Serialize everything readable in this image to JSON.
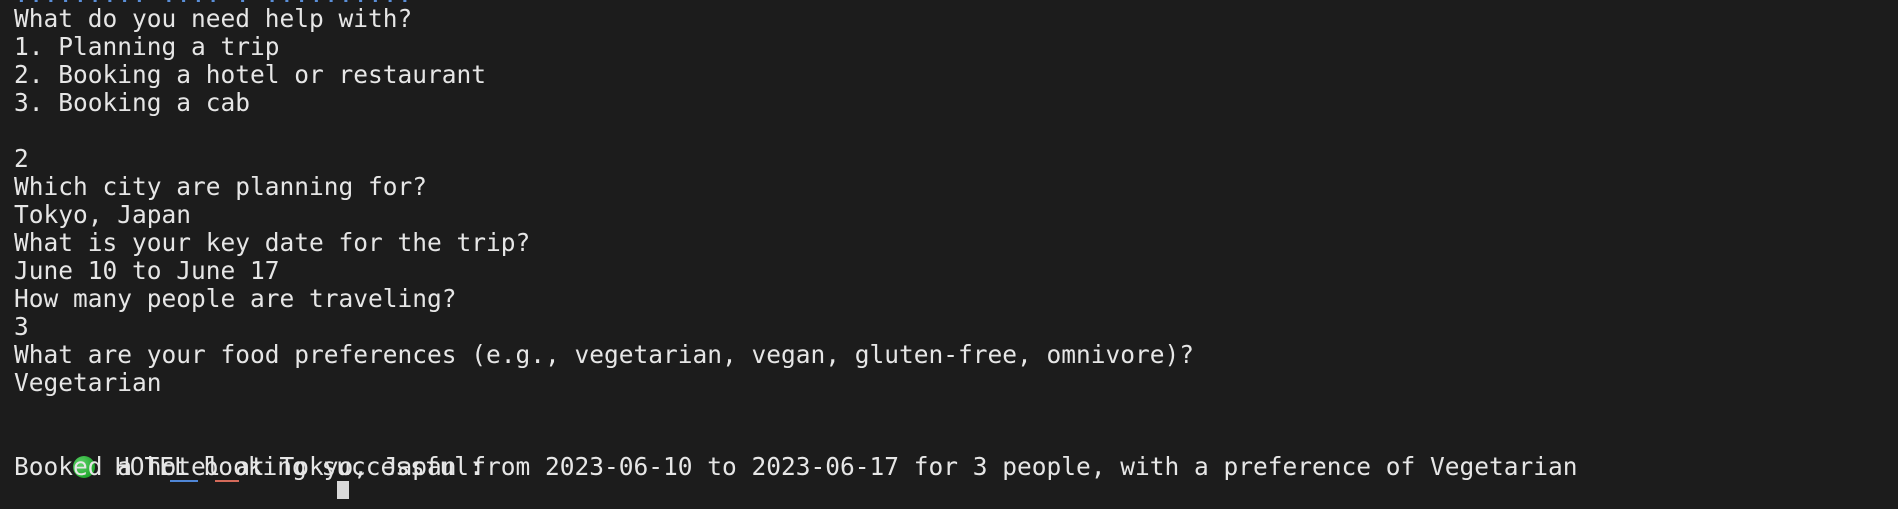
{
  "terminal": {
    "partial_header": "......... .... . ..........",
    "lines": [
      "What do you need help with?",
      "1. Planning a trip",
      "2. Booking a hotel or restaurant",
      "3. Booking a cab",
      "",
      "2",
      "Which city are planning for?",
      "Tokyo, Japan",
      "What is your key date for the trip?",
      "June 10 to June 17",
      "How many people are traveling?",
      "3",
      "What are your food preferences (e.g., vegetarian, vegan, gluten-free, omnivore)?",
      "Vegetarian",
      "",
      "HOTEL booking successful:",
      "Booked a hotel at Tokyo, Japan from 2023-06-10 to 2023-06-17 for 3 people, with a preference of Vegetarian"
    ],
    "success_icon": "green-circle-icon",
    "colors": {
      "background": "#1c1c1c",
      "text": "#e6e6e6",
      "success": "#2db83a",
      "prompt_blue": "#4f86d6",
      "prompt_red": "#d46a5a"
    }
  }
}
